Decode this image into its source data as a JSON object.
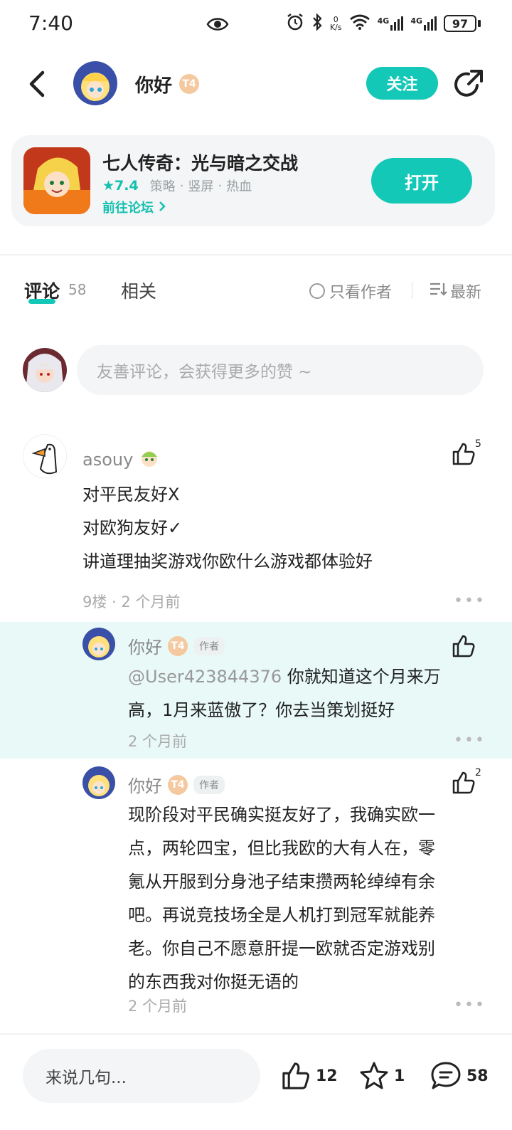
{
  "status_bar": {
    "time": "7:40",
    "net_speed_value": "0",
    "net_speed_unit": "K/s",
    "network_1": "4G",
    "network_2": "4G",
    "battery": "97"
  },
  "header": {
    "username": "你好",
    "level_badge": "T4",
    "follow_label": "关注"
  },
  "game_card": {
    "title": "七人传奇：光与暗之交战",
    "rating": "★7.4",
    "tags": [
      "策略",
      "竖屏",
      "热血"
    ],
    "tag_separator": "·",
    "forum_link": "前往论坛",
    "open_label": "打开"
  },
  "tabs": {
    "comments_label": "评论",
    "comments_count": "58",
    "related_label": "相关",
    "only_author_label": "只看作者",
    "sort_label": "最新"
  },
  "comment_input": {
    "placeholder": "友善评论，会获得更多的赞 ~"
  },
  "comments": [
    {
      "username": "asouy",
      "likes": "5",
      "lines": [
        "对平民友好X",
        "对欧狗友好✓",
        "讲道理抽奖游戏你欧什么游戏都体验好"
      ],
      "meta": "9楼 · 2 个月前"
    }
  ],
  "replies": [
    {
      "username": "你好",
      "level_badge": "T4",
      "author_tag": "作者",
      "likes": "",
      "mention": "@User423844376",
      "lines": [
        " 你就知道这个月来万",
        "高，1月来蓝傲了？你去当策划挺好"
      ],
      "meta": "2 个月前"
    },
    {
      "username": "你好",
      "level_badge": "T4",
      "author_tag": "作者",
      "likes": "2",
      "lines": [
        "现阶段对平民确实挺友好了，我确实欧一",
        "点，两轮四宝，但比我欧的大有人在，零",
        "氪从开服到分身池子结束攒两轮绰绰有余",
        "吧。再说竞技场全是人机打到冠军就能养",
        "老。你自己不愿意肝提一欧就否定游戏别",
        "的东西我对你挺无语的"
      ],
      "meta": "2 个月前"
    }
  ],
  "more_label": "•••",
  "bottom_bar": {
    "input_placeholder": "来说几句...",
    "likes": "12",
    "favorites": "1",
    "comments": "58"
  },
  "colors": {
    "accent": "#14c8b8",
    "highlight_bg": "#e8f9f7",
    "badge": "#f5c9a0"
  }
}
